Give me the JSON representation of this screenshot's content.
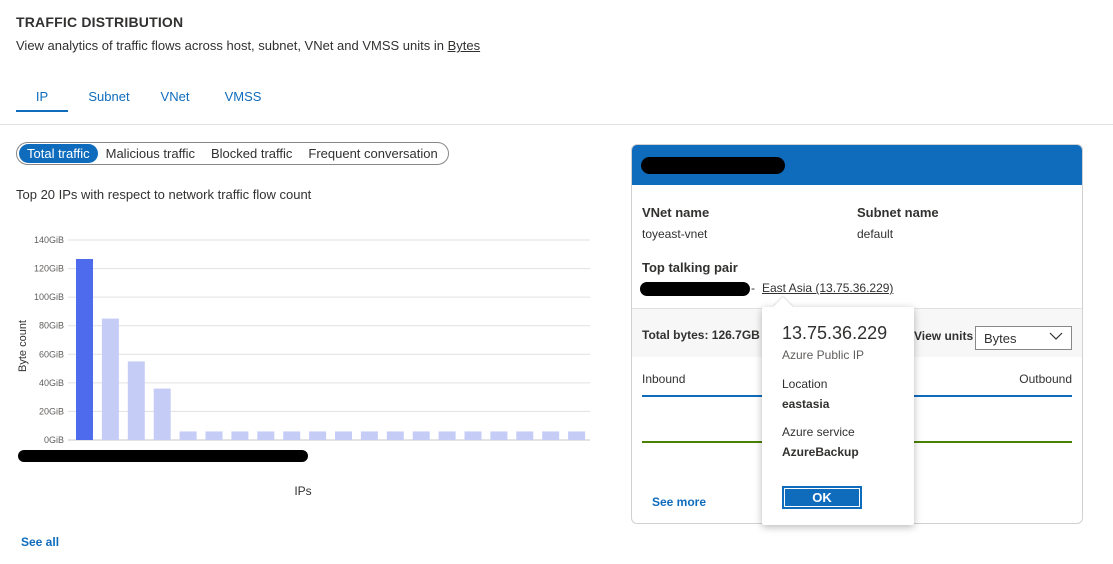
{
  "header": {
    "title": "TRAFFIC DISTRIBUTION",
    "description_prefix": "View analytics of traffic flows across host, subnet, VNet and VMSS units in ",
    "description_unit": "Bytes"
  },
  "tabs": [
    {
      "label": "IP",
      "active": true
    },
    {
      "label": "Subnet",
      "active": false
    },
    {
      "label": "VNet",
      "active": false
    },
    {
      "label": "VMSS",
      "active": false
    }
  ],
  "filters": [
    {
      "label": "Total traffic",
      "active": true
    },
    {
      "label": "Malicious traffic",
      "active": false
    },
    {
      "label": "Blocked traffic",
      "active": false
    },
    {
      "label": "Frequent conversation",
      "active": false
    }
  ],
  "chart_caption": "Top 20 IPs with respect to network traffic flow count",
  "chart_data": {
    "type": "bar",
    "xlabel": "IPs",
    "ylabel": "Byte count",
    "yticks": [
      "140GiB",
      "120GiB",
      "100GiB",
      "80GiB",
      "60GiB",
      "40GiB",
      "20GiB",
      "0GiB"
    ],
    "ylim": [
      0,
      140
    ],
    "values": [
      126.7,
      85,
      55,
      36,
      6,
      6,
      6,
      6,
      6,
      6,
      6,
      6,
      6,
      6,
      6,
      6,
      6,
      6,
      6,
      6
    ],
    "highlight_index": 0,
    "colors": {
      "highlight": "#4f6bed",
      "normal": "#c5cdf7",
      "grid": "#e1e1e1"
    }
  },
  "see_all": "See all",
  "card": {
    "vnet_label": "VNet name",
    "vnet_value": "toyeast-vnet",
    "subnet_label": "Subnet name",
    "subnet_value": "default",
    "pair_label": "Top talking pair",
    "pair_separator": "-",
    "pair_location": "East Asia (13.75.36.229)",
    "total_bytes": "Total bytes: 126.7GB",
    "view_units_label": "View units :",
    "view_units_value": "Bytes",
    "inbound": "Inbound",
    "outbound": "Outbound",
    "see_more": "See more",
    "accent": "#0f6cbd"
  },
  "popup": {
    "ip": "13.75.36.229",
    "type": "Azure Public IP",
    "location_label": "Location",
    "location_value": "eastasia",
    "service_label": "Azure service",
    "service_value": "AzureBackup",
    "ok_label": "OK"
  }
}
